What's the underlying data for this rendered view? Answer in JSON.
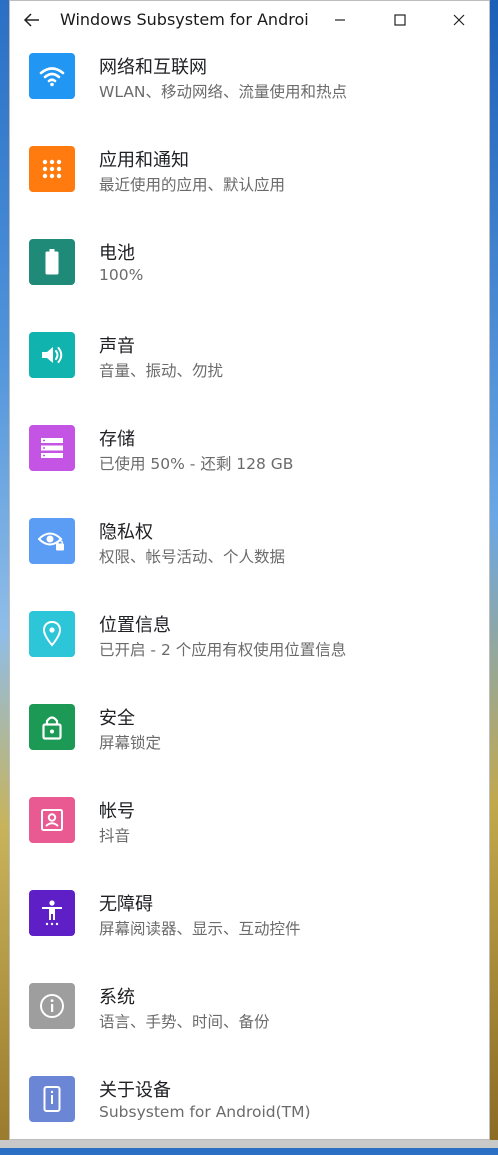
{
  "window": {
    "title": "Windows Subsystem for Androi...",
    "icons": {
      "back": "back-arrow-icon",
      "minimize": "minimize-icon",
      "maximize": "maximize-icon",
      "close": "close-icon"
    }
  },
  "settings": {
    "items": [
      {
        "title": "网络和互联网",
        "subtitle": "WLAN、移动网络、流量使用和热点",
        "icon": "wifi-icon",
        "color": "#2196f3"
      },
      {
        "title": "应用和通知",
        "subtitle": "最近使用的应用、默认应用",
        "icon": "apps-grid-icon",
        "color": "#ff7a0f"
      },
      {
        "title": "电池",
        "subtitle": "100%",
        "icon": "battery-icon",
        "color": "#1f8a78"
      },
      {
        "title": "声音",
        "subtitle": "音量、振动、勿扰",
        "icon": "volume-icon",
        "color": "#10b3ae"
      },
      {
        "title": "存储",
        "subtitle": "已使用 50% - 还剩 128 GB",
        "icon": "storage-icon",
        "color": "#c454e3"
      },
      {
        "title": "隐私权",
        "subtitle": "权限、帐号活动、个人数据",
        "icon": "privacy-eye-icon",
        "color": "#5b9cf5"
      },
      {
        "title": "位置信息",
        "subtitle": "已开启 - 2 个应用有权使用位置信息",
        "icon": "location-pin-icon",
        "color": "#2cc6d8"
      },
      {
        "title": "安全",
        "subtitle": "屏幕锁定",
        "icon": "lock-icon",
        "color": "#1b9955"
      },
      {
        "title": "帐号",
        "subtitle": "抖音",
        "icon": "account-box-icon",
        "color": "#ea5a92"
      },
      {
        "title": "无障碍",
        "subtitle": "屏幕阅读器、显示、互动控件",
        "icon": "accessibility-icon",
        "color": "#5e20c6"
      },
      {
        "title": "系统",
        "subtitle": "语言、手势、时间、备份",
        "icon": "info-icon",
        "color": "#9e9e9e"
      },
      {
        "title": "关于设备",
        "subtitle": "Subsystem for Android(TM)",
        "icon": "phone-device-icon",
        "color": "#6c86d6"
      }
    ]
  }
}
